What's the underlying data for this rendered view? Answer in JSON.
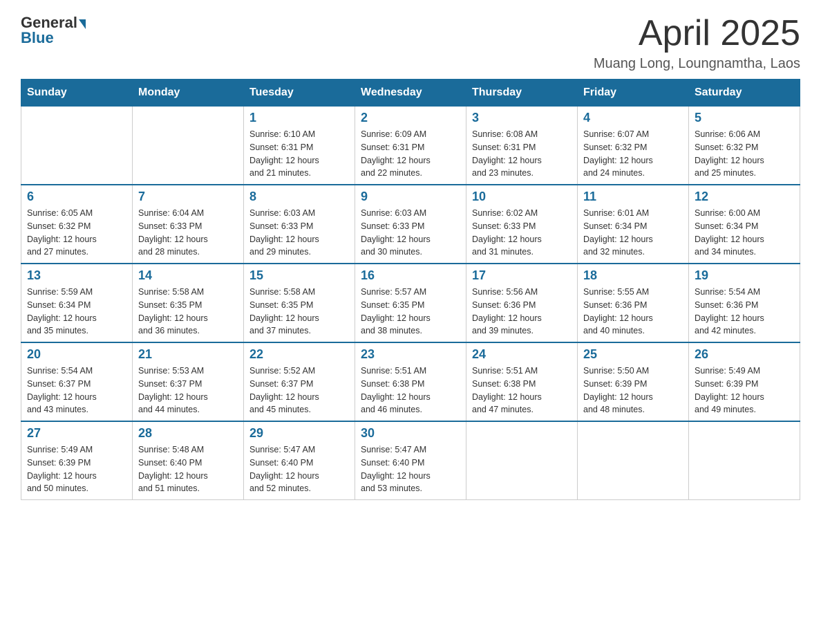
{
  "header": {
    "logo": {
      "general": "General",
      "blue": "Blue",
      "underline": "Blue"
    },
    "title": "April 2025",
    "location": "Muang Long, Loungnamtha, Laos"
  },
  "weekdays": [
    "Sunday",
    "Monday",
    "Tuesday",
    "Wednesday",
    "Thursday",
    "Friday",
    "Saturday"
  ],
  "weeks": [
    [
      {
        "day": "",
        "info": ""
      },
      {
        "day": "",
        "info": ""
      },
      {
        "day": "1",
        "info": "Sunrise: 6:10 AM\nSunset: 6:31 PM\nDaylight: 12 hours\nand 21 minutes."
      },
      {
        "day": "2",
        "info": "Sunrise: 6:09 AM\nSunset: 6:31 PM\nDaylight: 12 hours\nand 22 minutes."
      },
      {
        "day": "3",
        "info": "Sunrise: 6:08 AM\nSunset: 6:31 PM\nDaylight: 12 hours\nand 23 minutes."
      },
      {
        "day": "4",
        "info": "Sunrise: 6:07 AM\nSunset: 6:32 PM\nDaylight: 12 hours\nand 24 minutes."
      },
      {
        "day": "5",
        "info": "Sunrise: 6:06 AM\nSunset: 6:32 PM\nDaylight: 12 hours\nand 25 minutes."
      }
    ],
    [
      {
        "day": "6",
        "info": "Sunrise: 6:05 AM\nSunset: 6:32 PM\nDaylight: 12 hours\nand 27 minutes."
      },
      {
        "day": "7",
        "info": "Sunrise: 6:04 AM\nSunset: 6:33 PM\nDaylight: 12 hours\nand 28 minutes."
      },
      {
        "day": "8",
        "info": "Sunrise: 6:03 AM\nSunset: 6:33 PM\nDaylight: 12 hours\nand 29 minutes."
      },
      {
        "day": "9",
        "info": "Sunrise: 6:03 AM\nSunset: 6:33 PM\nDaylight: 12 hours\nand 30 minutes."
      },
      {
        "day": "10",
        "info": "Sunrise: 6:02 AM\nSunset: 6:33 PM\nDaylight: 12 hours\nand 31 minutes."
      },
      {
        "day": "11",
        "info": "Sunrise: 6:01 AM\nSunset: 6:34 PM\nDaylight: 12 hours\nand 32 minutes."
      },
      {
        "day": "12",
        "info": "Sunrise: 6:00 AM\nSunset: 6:34 PM\nDaylight: 12 hours\nand 34 minutes."
      }
    ],
    [
      {
        "day": "13",
        "info": "Sunrise: 5:59 AM\nSunset: 6:34 PM\nDaylight: 12 hours\nand 35 minutes."
      },
      {
        "day": "14",
        "info": "Sunrise: 5:58 AM\nSunset: 6:35 PM\nDaylight: 12 hours\nand 36 minutes."
      },
      {
        "day": "15",
        "info": "Sunrise: 5:58 AM\nSunset: 6:35 PM\nDaylight: 12 hours\nand 37 minutes."
      },
      {
        "day": "16",
        "info": "Sunrise: 5:57 AM\nSunset: 6:35 PM\nDaylight: 12 hours\nand 38 minutes."
      },
      {
        "day": "17",
        "info": "Sunrise: 5:56 AM\nSunset: 6:36 PM\nDaylight: 12 hours\nand 39 minutes."
      },
      {
        "day": "18",
        "info": "Sunrise: 5:55 AM\nSunset: 6:36 PM\nDaylight: 12 hours\nand 40 minutes."
      },
      {
        "day": "19",
        "info": "Sunrise: 5:54 AM\nSunset: 6:36 PM\nDaylight: 12 hours\nand 42 minutes."
      }
    ],
    [
      {
        "day": "20",
        "info": "Sunrise: 5:54 AM\nSunset: 6:37 PM\nDaylight: 12 hours\nand 43 minutes."
      },
      {
        "day": "21",
        "info": "Sunrise: 5:53 AM\nSunset: 6:37 PM\nDaylight: 12 hours\nand 44 minutes."
      },
      {
        "day": "22",
        "info": "Sunrise: 5:52 AM\nSunset: 6:37 PM\nDaylight: 12 hours\nand 45 minutes."
      },
      {
        "day": "23",
        "info": "Sunrise: 5:51 AM\nSunset: 6:38 PM\nDaylight: 12 hours\nand 46 minutes."
      },
      {
        "day": "24",
        "info": "Sunrise: 5:51 AM\nSunset: 6:38 PM\nDaylight: 12 hours\nand 47 minutes."
      },
      {
        "day": "25",
        "info": "Sunrise: 5:50 AM\nSunset: 6:39 PM\nDaylight: 12 hours\nand 48 minutes."
      },
      {
        "day": "26",
        "info": "Sunrise: 5:49 AM\nSunset: 6:39 PM\nDaylight: 12 hours\nand 49 minutes."
      }
    ],
    [
      {
        "day": "27",
        "info": "Sunrise: 5:49 AM\nSunset: 6:39 PM\nDaylight: 12 hours\nand 50 minutes."
      },
      {
        "day": "28",
        "info": "Sunrise: 5:48 AM\nSunset: 6:40 PM\nDaylight: 12 hours\nand 51 minutes."
      },
      {
        "day": "29",
        "info": "Sunrise: 5:47 AM\nSunset: 6:40 PM\nDaylight: 12 hours\nand 52 minutes."
      },
      {
        "day": "30",
        "info": "Sunrise: 5:47 AM\nSunset: 6:40 PM\nDaylight: 12 hours\nand 53 minutes."
      },
      {
        "day": "",
        "info": ""
      },
      {
        "day": "",
        "info": ""
      },
      {
        "day": "",
        "info": ""
      }
    ]
  ]
}
